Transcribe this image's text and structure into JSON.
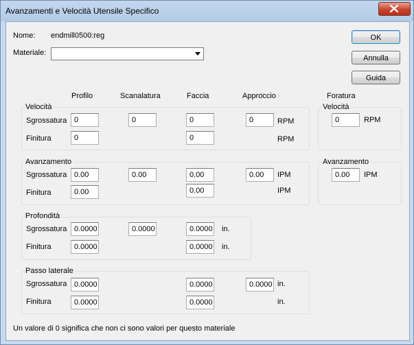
{
  "window": {
    "title": "Avanzamenti e Velocità Utensile Specifico"
  },
  "header": {
    "name_label": "Nome:",
    "name_value": "endmill0500:reg",
    "material_label": "Materiale:",
    "material_value": ""
  },
  "buttons": {
    "ok": "OK",
    "cancel": "Annulla",
    "help": "Guida"
  },
  "columns": {
    "profilo": "Profilo",
    "scanalatura": "Scanalatura",
    "faccia": "Faccia",
    "approccio": "Approccio",
    "foratura": "Foratura"
  },
  "rows": {
    "sgrossatura": "Sgrossatura",
    "finitura": "Finitura"
  },
  "velocita": {
    "label": "Velocità",
    "sgrossatura": {
      "profilo": "0",
      "scanalatura": "0",
      "faccia": "0",
      "approccio": "0",
      "unit": "RPM"
    },
    "finitura": {
      "profilo": "0",
      "faccia": "0",
      "unit": "RPM"
    }
  },
  "avanzamento": {
    "label": "Avanzamento",
    "sgrossatura": {
      "profilo": "0.00",
      "scanalatura": "0.00",
      "faccia": "0.00",
      "approccio": "0.00",
      "unit": "IPM"
    },
    "finitura": {
      "profilo": "0.00",
      "faccia": "0.00",
      "unit": "IPM"
    }
  },
  "profondita": {
    "label": "Profondità",
    "sgrossatura": {
      "profilo": "0.0000",
      "scanalatura": "0.0000",
      "faccia": "0.0000",
      "unit": "in."
    },
    "finitura": {
      "profilo": "0.0000",
      "faccia": "0.0000",
      "unit": "in."
    }
  },
  "passo": {
    "label": "Passo laterale",
    "sgrossatura": {
      "profilo": "0.0000",
      "faccia": "0.0000",
      "approccio": "0.0000",
      "unit": "in."
    },
    "finitura": {
      "profilo": "0.0000",
      "faccia": "0.0000",
      "unit": "in."
    }
  },
  "foratura": {
    "velocita_label": "Velocità",
    "velocita_value": "0",
    "velocita_unit": "RPM",
    "avanzamento_label": "Avanzamento",
    "avanzamento_value": "0.00",
    "avanzamento_unit": "IPM"
  },
  "footer": {
    "note": "Un valore di 0 significa che non ci sono valori per questo materiale"
  }
}
